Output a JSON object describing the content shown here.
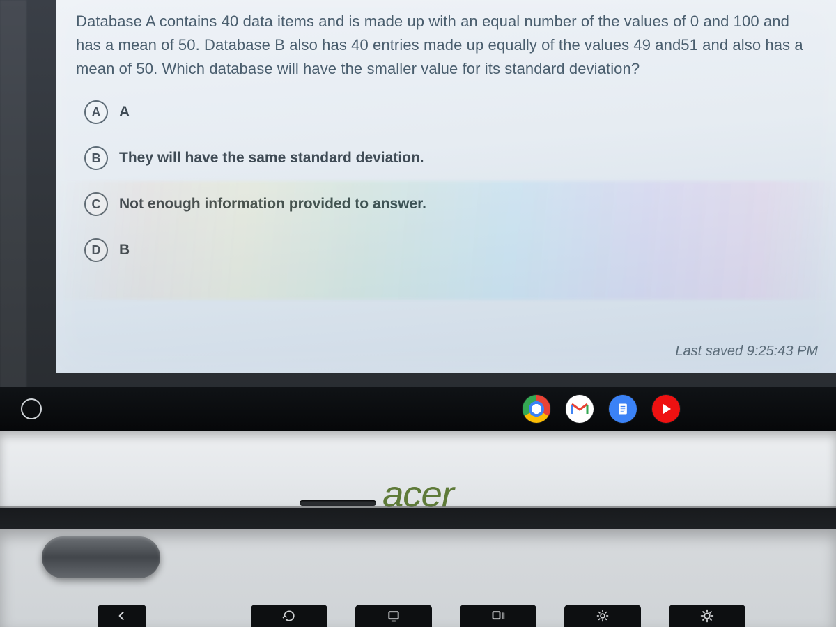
{
  "question": {
    "text": "Database A contains 40 data items and is made up with an equal number of the values of 0 and 100 and has a mean of 50. Database B also has 40 entries made up equally of the values 49 and51 and also has a mean of 50. Which database will have the smaller value for its standard deviation?"
  },
  "options": [
    {
      "letter": "A",
      "text": "A"
    },
    {
      "letter": "B",
      "text": "They will have the same standard deviation."
    },
    {
      "letter": "C",
      "text": "Not enough information provided to answer."
    },
    {
      "letter": "D",
      "text": "B"
    }
  ],
  "status": {
    "last_saved_label": "Last saved 9:25:43 PM"
  },
  "shelf": {
    "apps": {
      "chrome": "Google Chrome",
      "gmail": "Gmail",
      "docs": "Google Docs",
      "youtube": "YouTube"
    }
  },
  "device": {
    "brand": "acer"
  }
}
